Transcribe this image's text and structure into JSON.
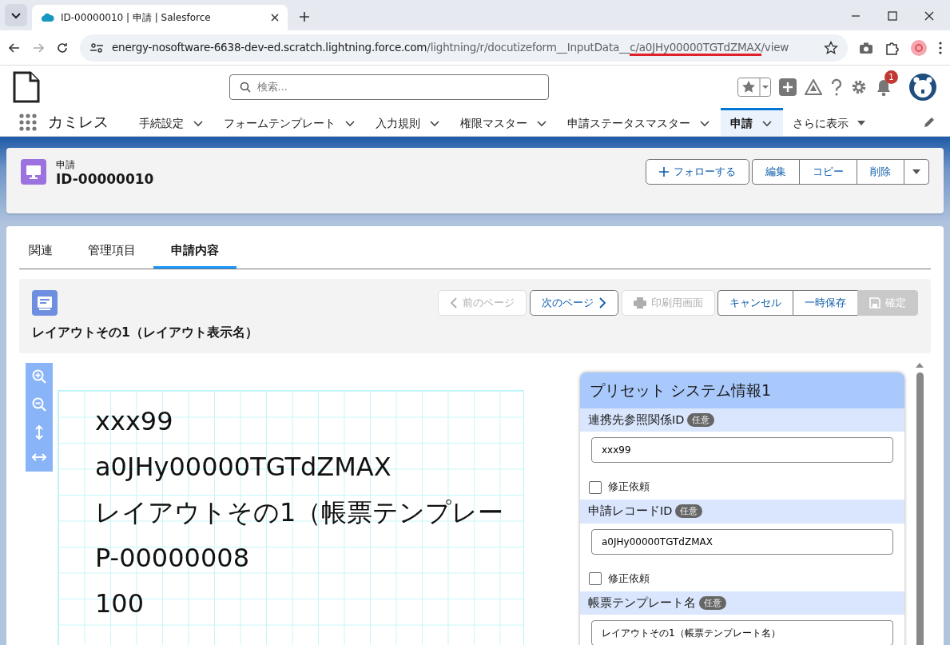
{
  "browser": {
    "tab_title": "ID-00000010 | 申請 | Salesforce",
    "url": {
      "host": "energy-nosoftware-6638-dev-ed.scratch.lightning.force.com",
      "path": "/lightning/r/docutizeform__InputData__",
      "marked": "c/a0JHy00000TGTdZMAX",
      "rest": "/view"
    }
  },
  "header": {
    "search_placeholder": "検索...",
    "notification_count": "1"
  },
  "nav": {
    "app_name": "カミレス",
    "items": [
      {
        "label": "手続設定",
        "selected": false,
        "kind": "menu"
      },
      {
        "label": "フォームテンプレート",
        "selected": false,
        "kind": "menu"
      },
      {
        "label": "入力規則",
        "selected": false,
        "kind": "menu"
      },
      {
        "label": "権限マスター",
        "selected": false,
        "kind": "menu"
      },
      {
        "label": "申請ステータスマスター",
        "selected": false,
        "kind": "menu"
      },
      {
        "label": "申請",
        "selected": true,
        "kind": "menu"
      },
      {
        "label": "さらに表示",
        "selected": false,
        "kind": "more"
      }
    ]
  },
  "record": {
    "object_label": "申請",
    "title": "ID-00000010",
    "follow": "フォローする",
    "actions": [
      "編集",
      "コピー",
      "削除"
    ]
  },
  "tabs": [
    {
      "label": "関連",
      "selected": false
    },
    {
      "label": "管理項目",
      "selected": false
    },
    {
      "label": "申請内容",
      "selected": true
    }
  ],
  "form": {
    "title": "レイアウトその1（レイアウト表示名）",
    "buttons": [
      {
        "label": "前のページ",
        "kind": "prev",
        "disabled": true
      },
      {
        "label": "次のページ",
        "kind": "next",
        "disabled": false
      },
      {
        "label": "印刷用画面",
        "kind": "print",
        "disabled": true
      },
      {
        "label": "キャンセル",
        "kind": "plain",
        "disabled": false
      },
      {
        "label": "一時保存",
        "kind": "plain",
        "disabled": false
      },
      {
        "label": "確定",
        "kind": "save",
        "disabled": true
      }
    ]
  },
  "preview": {
    "lines": [
      "xxx99",
      "a0JHy00000TGTdZMAX",
      "レイアウトその1（帳票テンプレー",
      "P-00000008",
      "100"
    ]
  },
  "panel": {
    "title": "プリセット システム情報1",
    "fields": [
      {
        "label": "連携先参照関係ID",
        "badge": "任意",
        "value": "xxx99",
        "request": {
          "label": "修正依頼",
          "checked": false
        }
      },
      {
        "label": "申請レコードID",
        "badge": "任意",
        "value": "a0JHy00000TGTdZMAX",
        "request": {
          "label": "修正依頼",
          "checked": false
        }
      },
      {
        "label": "帳票テンプレート名",
        "badge": "任意",
        "value": "レイアウトその1（帳票テンプレート名）"
      }
    ]
  }
}
